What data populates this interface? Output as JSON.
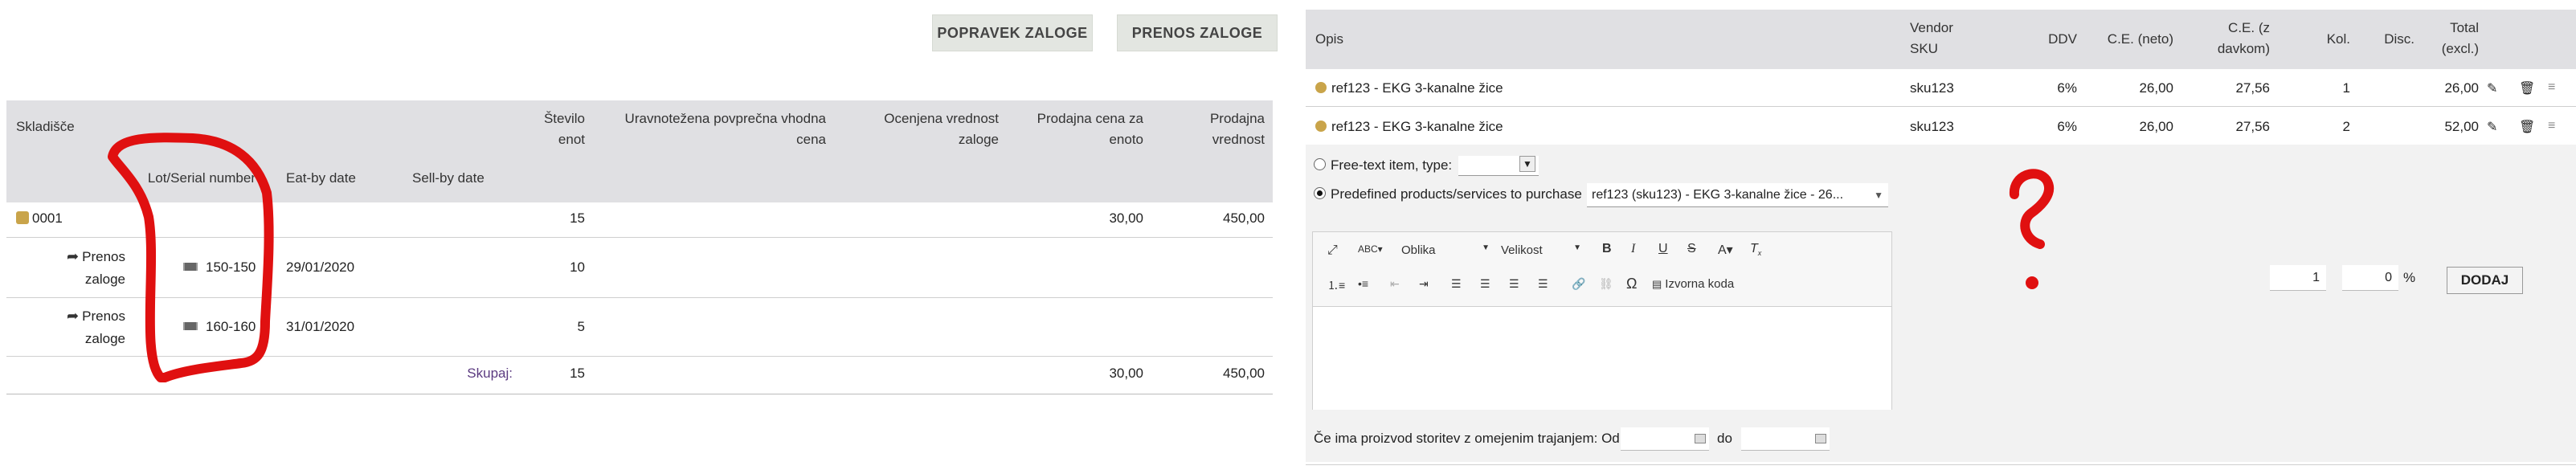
{
  "stock": {
    "buttons": {
      "popravek": "POPRAVEK ZALOGE",
      "prenos": "PRENOS ZALOGE"
    },
    "headers": {
      "warehouse": "Skladišče",
      "lot": "Lot/Serial number",
      "eatby": "Eat-by date",
      "sellby": "Sell-by date",
      "units_l1": "Število",
      "units_l2": "enot",
      "wap_l1": "Uravnotežena povprečna vhodna",
      "wap_l2": "cena",
      "est_l1": "Ocenjena vrednost",
      "est_l2": "zaloge",
      "sell_l1": "Prodajna cena za",
      "sell_l2": "enoto",
      "sellval_l1": "Prodajna",
      "sellval_l2": "vrednost"
    },
    "rows": [
      {
        "warehouse": "0001",
        "units": "15",
        "sell_price": "30,00",
        "sell_value": "450,00"
      },
      {
        "transfer_l1": "Prenos",
        "transfer_l2": "zaloge",
        "lot": "150-150",
        "eatby": "29/01/2020",
        "units": "10"
      },
      {
        "transfer_l1": "Prenos",
        "transfer_l2": "zaloge",
        "lot": "160-160",
        "eatby": "31/01/2020",
        "units": "5"
      }
    ],
    "footer": {
      "label": "Skupaj:",
      "units": "15",
      "sell_price": "30,00",
      "sell_value": "450,00"
    }
  },
  "order": {
    "headers": {
      "desc": "Opis",
      "sku_l1": "Vendor",
      "sku_l2": "SKU",
      "vat": "DDV",
      "net_l1": "C.E. (neto)",
      "tax_l1": "C.E. (z",
      "tax_l2": "davkom)",
      "qty": "Kol.",
      "disc": "Disc.",
      "total_l1": "Total",
      "total_l2": "(excl.)"
    },
    "lines": [
      {
        "desc": "ref123 - EKG 3-kanalne žice",
        "sku": "sku123",
        "vat": "6%",
        "net": "26,00",
        "tax": "27,56",
        "qty": "1",
        "total": "26,00"
      },
      {
        "desc": "ref123 - EKG 3-kanalne žice",
        "sku": "sku123",
        "vat": "6%",
        "net": "26,00",
        "tax": "27,56",
        "qty": "2",
        "total": "52,00"
      }
    ],
    "form": {
      "free_text_label": "Free-text item, type:",
      "predefined_label": "Predefined products/services to purchase",
      "predefined_value": "ref123 (sku123) - EKG 3-kanalne žice - 26...",
      "editor": {
        "style": "Oblika",
        "size": "Velikost",
        "source": "Izvorna koda"
      },
      "qty_value": "1",
      "disc_value": "0",
      "disc_unit": "%",
      "add_button": "DODAJ",
      "period_label": "Če ima proizvod storitev z omejenim trajanjem: Od",
      "period_to": "do"
    }
  },
  "annotations": {
    "question_mark": "?"
  },
  "colors": {
    "header_bg": "#e0e0e3",
    "annotation_red": "#e01010",
    "button_bg": "#e3e6e1"
  }
}
